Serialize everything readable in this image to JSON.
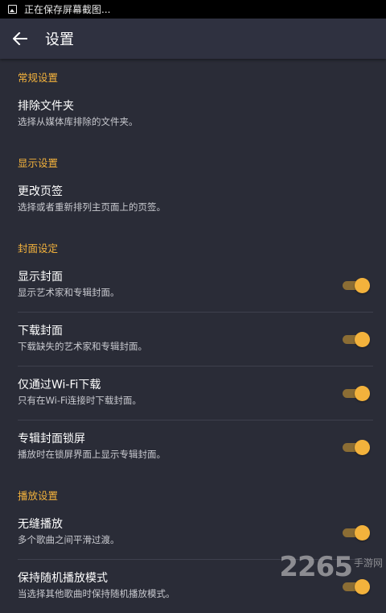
{
  "statusbar": {
    "text": "正在保存屏幕截图..."
  },
  "appbar": {
    "title": "设置"
  },
  "sections": [
    {
      "header": "常规设置",
      "items": [
        {
          "title": "排除文件夹",
          "subtitle": "选择从媒体库排除的文件夹。"
        }
      ]
    },
    {
      "header": "显示设置",
      "items": [
        {
          "title": "更改页签",
          "subtitle": "选择或者重新排列主页面上的页签。"
        }
      ]
    },
    {
      "header": "封面设定",
      "items": [
        {
          "title": "显示封面",
          "subtitle": "显示艺术家和专辑封面。",
          "toggle": true
        },
        {
          "title": "下载封面",
          "subtitle": "下载缺失的艺术家和专辑封面。",
          "toggle": true
        },
        {
          "title": "仅通过Wi-Fi下载",
          "subtitle": "只有在Wi-Fi连接时下载封面。",
          "toggle": true
        },
        {
          "title": "专辑封面锁屏",
          "subtitle": "播放时在锁屏界面上显示专辑封面。",
          "toggle": true
        }
      ]
    },
    {
      "header": "播放设置",
      "items": [
        {
          "title": "无缝播放",
          "subtitle": "多个歌曲之间平滑过渡。",
          "toggle": true
        },
        {
          "title": "保持随机播放模式",
          "subtitle": "当选择其他歌曲时保持随机播放模式。",
          "toggle": true
        }
      ]
    }
  ],
  "watermark": {
    "number": "2265",
    "text": "手游网"
  },
  "colors": {
    "accent": "#f3b23c",
    "background": "#2a2c37",
    "appbar": "#2f3140"
  }
}
